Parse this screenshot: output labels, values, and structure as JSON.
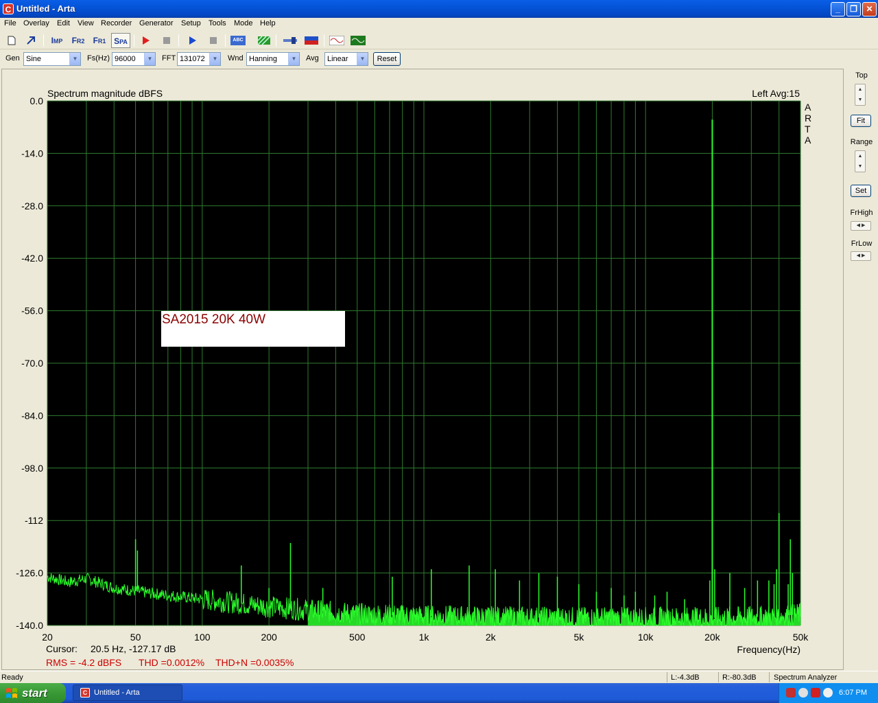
{
  "window": {
    "title": "Untitled - Arta",
    "app_icon": "arta-icon"
  },
  "menu": [
    "File",
    "Overlay",
    "Edit",
    "View",
    "Recorder",
    "Generator",
    "Setup",
    "Tools",
    "Mode",
    "Help"
  ],
  "toolbar": {
    "imp_main": "I",
    "imp_sub": "MP",
    "fr2_main": "F",
    "fr2_sub": "R2",
    "fr1_main": "F",
    "fr1_sub": "R1",
    "spa_main": "S",
    "spa_sub": "PA",
    "abc_label": "ABC"
  },
  "controls": {
    "gen_label": "Gen",
    "gen_value": "Sine",
    "fs_label": "Fs(Hz)",
    "fs_value": "96000",
    "fft_label": "FFT",
    "fft_value": "131072",
    "wnd_label": "Wnd",
    "wnd_value": "Hanning",
    "avg_label": "Avg",
    "avg_value": "Linear",
    "reset_label": "Reset"
  },
  "right_panel": {
    "top_label": "Top",
    "fit_label": "Fit",
    "range_label": "Range",
    "set_label": "Set",
    "frhigh_label": "FrHigh",
    "frlow_label": "FrLow"
  },
  "plot": {
    "title": "Spectrum magnitude dBFS",
    "channel_info": "Left  Avg:15",
    "arta_letters": [
      "A",
      "R",
      "T",
      "A"
    ],
    "annotation": "SA2015 20K 40W",
    "xlabel": "Frequency(Hz)",
    "cursor_label": "Cursor:",
    "cursor_value": "20.5 Hz, -127.17 dB",
    "rms_text": "RMS =   -4.2 dBFS",
    "thd_text": "THD =0.0012%",
    "thdn_text": "THD+N =0.0035%",
    "colors": {
      "background": "#000000",
      "grid": "#2f7d2f",
      "trace": "#2bff2b",
      "annotation_text": "#8b0000",
      "stats_text": "#cc0000"
    }
  },
  "chart_data": {
    "type": "line",
    "title": "Spectrum magnitude dBFS",
    "xlabel": "Frequency(Hz)",
    "ylabel": "",
    "xscale": "log",
    "xlim": [
      20,
      50000
    ],
    "ylim": [
      -140,
      0
    ],
    "x_ticks": [
      20,
      50,
      100,
      200,
      500,
      1000,
      2000,
      5000,
      10000,
      20000,
      50000
    ],
    "x_tick_labels": [
      "20",
      "50",
      "100",
      "200",
      "500",
      "1k",
      "2k",
      "5k",
      "10k",
      "20k",
      "50k"
    ],
    "y_ticks": [
      0,
      -14,
      -28,
      -42,
      -56,
      -70,
      -84,
      -98,
      -112,
      -126,
      -140
    ],
    "y_tick_labels": [
      "0.0",
      "-14.0",
      "-28.0",
      "-42.0",
      "-56.0",
      "-70.0",
      "-84.0",
      "-98.0",
      "-112",
      "-126.0",
      "-140.0"
    ],
    "noise_floor": [
      [
        20,
        -127
      ],
      [
        25,
        -128.5
      ],
      [
        30,
        -127.5
      ],
      [
        40,
        -130
      ],
      [
        60,
        -131.5
      ],
      [
        100,
        -133
      ],
      [
        200,
        -135
      ],
      [
        500,
        -137
      ],
      [
        1000,
        -137.5
      ],
      [
        2000,
        -137.8
      ],
      [
        5000,
        -138
      ],
      [
        10000,
        -138
      ],
      [
        20000,
        -138
      ],
      [
        30000,
        -137.8
      ],
      [
        40000,
        -137.5
      ],
      [
        50000,
        -137
      ]
    ],
    "peaks": [
      {
        "f": 20000,
        "db": -5
      },
      {
        "f": 50,
        "db": -117
      },
      {
        "f": 51,
        "db": -120
      },
      {
        "f": 150,
        "db": -124
      },
      {
        "f": 250,
        "db": -118
      },
      {
        "f": 200,
        "db": -130
      },
      {
        "f": 350,
        "db": -130
      },
      {
        "f": 720,
        "db": -127
      },
      {
        "f": 1080,
        "db": -125
      },
      {
        "f": 1600,
        "db": -124
      },
      {
        "f": 2100,
        "db": -125
      },
      {
        "f": 2700,
        "db": -128
      },
      {
        "f": 3300,
        "db": -126
      },
      {
        "f": 4000,
        "db": -127
      },
      {
        "f": 5000,
        "db": -129
      },
      {
        "f": 6000,
        "db": -131
      },
      {
        "f": 7000,
        "db": -130
      },
      {
        "f": 8000,
        "db": -132
      },
      {
        "f": 9000,
        "db": -131
      },
      {
        "f": 11000,
        "db": -132
      },
      {
        "f": 12500,
        "db": -131
      },
      {
        "f": 15000,
        "db": -133
      },
      {
        "f": 20500,
        "db": -125
      },
      {
        "f": 19500,
        "db": -128
      },
      {
        "f": 24000,
        "db": -126
      },
      {
        "f": 28000,
        "db": -130
      },
      {
        "f": 32000,
        "db": -128
      },
      {
        "f": 36000,
        "db": -128
      },
      {
        "f": 38000,
        "db": -129
      },
      {
        "f": 40000,
        "db": -110
      },
      {
        "f": 39000,
        "db": -125
      },
      {
        "f": 44000,
        "db": -129
      },
      {
        "f": 45000,
        "db": -117
      },
      {
        "f": 46000,
        "db": -126
      }
    ]
  },
  "status": {
    "left": "Ready",
    "l_level": "L:-4.3dB",
    "r_level": "R:-80.3dB",
    "mode": "Spectrum Analyzer"
  },
  "taskbar": {
    "start_label": "start",
    "task_label": "Untitled - Arta",
    "clock": "6:07 PM"
  }
}
